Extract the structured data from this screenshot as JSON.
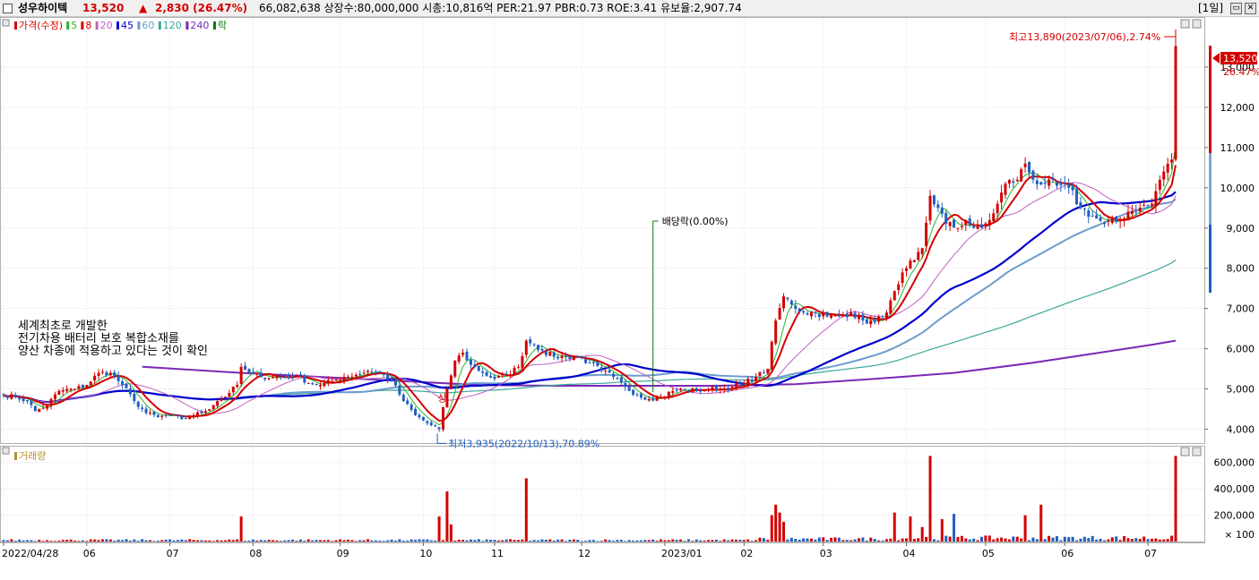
{
  "header": {
    "stock_name": "성우하이텍",
    "price": "13,520",
    "up_symbol": "▲",
    "change": "2,830 (26.47%)",
    "info": "66,082,638  상장수:80,000,000  시총:10,816억  PER:21.97  PBR:0.73  ROE:3.41  유보율:2,907.74",
    "period": "[1일]"
  },
  "price_panel": {
    "legend": [
      {
        "label": "가격(수정)",
        "color": "#d40000"
      },
      {
        "label": "5",
        "color": "#2db02d"
      },
      {
        "label": "8",
        "color": "#d40000"
      },
      {
        "label": "20",
        "color": "#c060c0"
      },
      {
        "label": "45",
        "color": "#0000cc"
      },
      {
        "label": "60",
        "color": "#6a9ccd"
      },
      {
        "label": "120",
        "color": "#3aa89a"
      },
      {
        "label": "240",
        "color": "#7a28b4"
      },
      {
        "label": "락",
        "color": "#0a7a0a"
      }
    ],
    "annotation_lines": [
      "세계최초로 개발한",
      "전기차용 배터리 보호 복합소재를",
      "양산 차종에 적용하고 있다는 것이 확인"
    ],
    "high_label": "최고13,890(2023/07/06),2.74%",
    "low_label": "최저3,935(2022/10/13),70.89%",
    "dividend_label": "배당락(0.00%)",
    "limit_up_label": "상",
    "current_price_tag": "13,520",
    "current_change_tag": "26.47%"
  },
  "volume_panel": {
    "legend": "거래량"
  },
  "colors": {
    "up": "#d40000",
    "down": "#1f5fbf",
    "ma5": "#2db02d",
    "ma8": "#d40000",
    "ma20": "#c060c0",
    "ma45": "#0000cc",
    "ma60": "#6a9ccd",
    "ma120": "#3aa89a",
    "ma240": "#7a28b4"
  },
  "chart_data": {
    "type": "candlestick",
    "price_axis": {
      "ticks": [
        4000,
        5000,
        6000,
        7000,
        8000,
        9000,
        10000,
        11000,
        12000,
        13000
      ],
      "range": [
        3700,
        14200
      ]
    },
    "volume_axis": {
      "ticks": [
        100,
        200000,
        400000,
        600000
      ],
      "tick_labels": [
        "× 100",
        "200,000",
        "400,000",
        "600,000"
      ],
      "range": [
        0,
        700000
      ]
    },
    "x_labels": [
      {
        "label": "2022/04/28",
        "day": 0
      },
      {
        "label": "06",
        "day": 21
      },
      {
        "label": "07",
        "day": 42
      },
      {
        "label": "08",
        "day": 63
      },
      {
        "label": "09",
        "day": 85
      },
      {
        "label": "10",
        "day": 106
      },
      {
        "label": "11",
        "day": 124
      },
      {
        "label": "12",
        "day": 146
      },
      {
        "label": "2023/01",
        "day": 167
      },
      {
        "label": "02",
        "day": 187
      },
      {
        "label": "03",
        "day": 207
      },
      {
        "label": "04",
        "day": 228
      },
      {
        "label": "05",
        "day": 248
      },
      {
        "label": "06",
        "day": 268
      },
      {
        "label": "07",
        "day": 289
      }
    ],
    "close_keypoints": [
      [
        0,
        4850
      ],
      [
        3,
        4800
      ],
      [
        6,
        4700
      ],
      [
        8,
        4450
      ],
      [
        11,
        4600
      ],
      [
        14,
        4950
      ],
      [
        18,
        5000
      ],
      [
        21,
        5100
      ],
      [
        24,
        5400
      ],
      [
        27,
        5400
      ],
      [
        30,
        5100
      ],
      [
        33,
        4700
      ],
      [
        36,
        4400
      ],
      [
        39,
        4300
      ],
      [
        42,
        4350
      ],
      [
        45,
        4250
      ],
      [
        48,
        4350
      ],
      [
        51,
        4450
      ],
      [
        54,
        4700
      ],
      [
        57,
        4900
      ],
      [
        59,
        5100
      ],
      [
        60,
        5550
      ],
      [
        62,
        5400
      ],
      [
        65,
        5300
      ],
      [
        68,
        5300
      ],
      [
        71,
        5300
      ],
      [
        74,
        5350
      ],
      [
        77,
        5150
      ],
      [
        80,
        5100
      ],
      [
        83,
        5200
      ],
      [
        86,
        5300
      ],
      [
        89,
        5350
      ],
      [
        92,
        5450
      ],
      [
        95,
        5400
      ],
      [
        98,
        5200
      ],
      [
        101,
        4700
      ],
      [
        104,
        4350
      ],
      [
        107,
        4150
      ],
      [
        110,
        4000
      ],
      [
        112,
        5000
      ],
      [
        114,
        5700
      ],
      [
        116,
        5900
      ],
      [
        118,
        5600
      ],
      [
        121,
        5400
      ],
      [
        124,
        5250
      ],
      [
        127,
        5350
      ],
      [
        130,
        5550
      ],
      [
        132,
        6200
      ],
      [
        134,
        6100
      ],
      [
        136,
        5950
      ],
      [
        139,
        5800
      ],
      [
        142,
        5800
      ],
      [
        145,
        5800
      ],
      [
        148,
        5650
      ],
      [
        151,
        5450
      ],
      [
        154,
        5300
      ],
      [
        157,
        5050
      ],
      [
        160,
        4850
      ],
      [
        163,
        4750
      ],
      [
        166,
        4800
      ],
      [
        169,
        4950
      ],
      [
        172,
        5000
      ],
      [
        175,
        4950
      ],
      [
        178,
        5000
      ],
      [
        181,
        5000
      ],
      [
        184,
        5050
      ],
      [
        187,
        5150
      ],
      [
        190,
        5300
      ],
      [
        193,
        5500
      ],
      [
        195,
        6700
      ],
      [
        197,
        7300
      ],
      [
        199,
        7100
      ],
      [
        202,
        6900
      ],
      [
        205,
        6900
      ],
      [
        208,
        6800
      ],
      [
        211,
        6800
      ],
      [
        214,
        6900
      ],
      [
        217,
        6700
      ],
      [
        220,
        6650
      ],
      [
        223,
        6900
      ],
      [
        226,
        7600
      ],
      [
        228,
        8000
      ],
      [
        230,
        8200
      ],
      [
        232,
        8500
      ],
      [
        234,
        9800
      ],
      [
        236,
        9500
      ],
      [
        238,
        9100
      ],
      [
        241,
        9000
      ],
      [
        243,
        9200
      ],
      [
        245,
        9000
      ],
      [
        247,
        9000
      ],
      [
        249,
        9200
      ],
      [
        251,
        9600
      ],
      [
        253,
        10100
      ],
      [
        256,
        10200
      ],
      [
        258,
        10600
      ],
      [
        260,
        10200
      ],
      [
        263,
        10100
      ],
      [
        266,
        10050
      ],
      [
        269,
        10000
      ],
      [
        272,
        9500
      ],
      [
        275,
        9300
      ],
      [
        278,
        9100
      ],
      [
        281,
        9150
      ],
      [
        284,
        9400
      ],
      [
        287,
        9500
      ],
      [
        290,
        9600
      ],
      [
        292,
        10200
      ],
      [
        294,
        10600
      ],
      [
        295,
        10700
      ],
      [
        296,
        13520
      ]
    ],
    "ma240_keypoints": [
      [
        35,
        5550
      ],
      [
        60,
        5400
      ],
      [
        80,
        5300
      ],
      [
        100,
        5200
      ],
      [
        120,
        5100
      ],
      [
        140,
        5080
      ],
      [
        160,
        5080
      ],
      [
        180,
        5080
      ],
      [
        200,
        5120
      ],
      [
        220,
        5250
      ],
      [
        240,
        5400
      ],
      [
        260,
        5650
      ],
      [
        280,
        5950
      ],
      [
        290,
        6100
      ],
      [
        296,
        6200
      ]
    ],
    "high": {
      "value": 13890,
      "date": "2023/07/06",
      "pct": "2.74%"
    },
    "low": {
      "value": 3935,
      "date": "2022/10/13",
      "pct": "70.89%"
    },
    "dividend_marker_day": 164,
    "limit_up_day": 111,
    "volume_spikes": [
      {
        "day": 60,
        "value": 190000,
        "up": true
      },
      {
        "day": 110,
        "value": 190000,
        "up": true
      },
      {
        "day": 112,
        "value": 380000,
        "up": true
      },
      {
        "day": 113,
        "value": 130000,
        "up": true
      },
      {
        "day": 132,
        "value": 480000,
        "up": true
      },
      {
        "day": 194,
        "value": 200000,
        "up": true
      },
      {
        "day": 195,
        "value": 280000,
        "up": true
      },
      {
        "day": 196,
        "value": 220000,
        "up": true
      },
      {
        "day": 197,
        "value": 150000,
        "up": true
      },
      {
        "day": 225,
        "value": 220000,
        "up": true
      },
      {
        "day": 229,
        "value": 190000,
        "up": true
      },
      {
        "day": 232,
        "value": 110000,
        "up": true
      },
      {
        "day": 234,
        "value": 650000,
        "up": true
      },
      {
        "day": 237,
        "value": 170000,
        "up": true
      },
      {
        "day": 240,
        "value": 210000,
        "up": false
      },
      {
        "day": 258,
        "value": 200000,
        "up": true
      },
      {
        "day": 262,
        "value": 280000,
        "up": true
      },
      {
        "day": 296,
        "value": 650000,
        "up": true
      }
    ]
  }
}
